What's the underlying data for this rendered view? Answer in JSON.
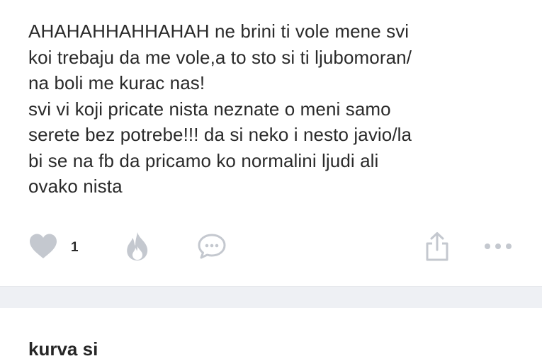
{
  "post": {
    "lines": [
      "AHAHAHHAHHAHAH ne brini ti vole mene svi",
      "koi trebaju da me vole,a to sto si ti ljubomoran/",
      "na boli me kurac nas!",
      "svi vi koji pricate nista neznate o meni samo",
      "serete bez potrebe!!! da si neko i nesto javio/la",
      "bi se na fb da pricamo ko normalini ljudi ali",
      "ovako nista"
    ]
  },
  "actions": {
    "like_count": "1",
    "icons": {
      "like": "heart-icon",
      "fire": "fire-icon",
      "comment": "speech-bubble-icon",
      "share": "share-icon",
      "more": "more-dots-icon"
    },
    "icon_color": "#c4c8cf"
  },
  "comment": {
    "text": "kurva si"
  },
  "colors": {
    "text": "#2a2a2a",
    "divider": "#eef0f4"
  }
}
